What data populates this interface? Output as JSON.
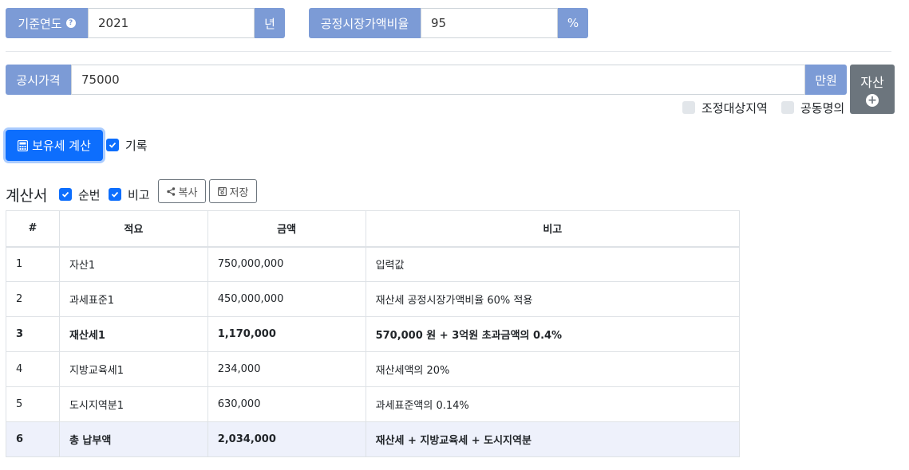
{
  "year": {
    "label": "기준연도",
    "value": "2021",
    "unit": "년",
    "help_icon": "question-circle-icon"
  },
  "market_ratio": {
    "label": "공정시장가액비율",
    "value": "95",
    "unit": "%"
  },
  "price": {
    "label": "공시가격",
    "value": "75000",
    "unit": "만원"
  },
  "asset_button": {
    "label": "자산",
    "icon": "plus-circle-icon"
  },
  "options": {
    "adjust_area": "조정대상지역",
    "joint_owner": "공동명의"
  },
  "calc_button": {
    "label": "보유세 계산",
    "icon": "calculator-icon"
  },
  "record_label": "기록",
  "report": {
    "title": "계산서",
    "seq_label": "순번",
    "note_label": "비고",
    "copy_label": "복사",
    "save_label": "저장",
    "headers": [
      "#",
      "적요",
      "금액",
      "비고"
    ],
    "rows": [
      [
        "1",
        "자산1",
        "750,000,000",
        "입력값"
      ],
      [
        "2",
        "과세표준1",
        "450,000,000",
        "재산세 공정시장가액비율 60% 적용"
      ],
      [
        "3",
        "재산세1",
        "1,170,000",
        "570,000 원 + 3억원 초과금액의 0.4%"
      ],
      [
        "4",
        "지방교육세1",
        "234,000",
        "재산세액의 20%"
      ],
      [
        "5",
        "도시지역분1",
        "630,000",
        "과세표준액의 0.14%"
      ],
      [
        "6",
        "총 납부액",
        "2,034,000",
        "재산세 + 지방교육세 + 도시지역분"
      ]
    ]
  },
  "colors": {
    "addon": "#7c9bd6",
    "primary": "#0d6efd",
    "secondary": "#6c757d",
    "total_row": "#eef1fb"
  }
}
